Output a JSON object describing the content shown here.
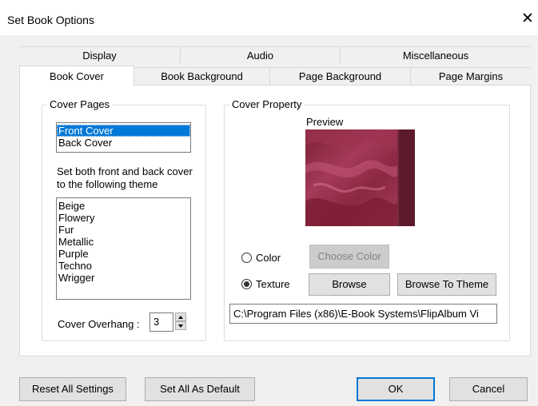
{
  "window": {
    "title": "Set Book Options",
    "close_glyph": "✕"
  },
  "tabs_back": [
    "Display",
    "Audio",
    "Miscellaneous"
  ],
  "tabs_front": [
    "Book Cover",
    "Book Background",
    "Page Background",
    "Page Margins"
  ],
  "cover_pages": {
    "group_label": "Cover Pages",
    "pages": [
      "Front Cover",
      "Back Cover"
    ],
    "selected_page": "Front Cover",
    "theme_instruction": "Set both front and back cover to the following theme",
    "themes": [
      "Beige",
      "Flowery",
      "Fur",
      "Metallic",
      "Purple",
      "Techno",
      "Wrigger"
    ],
    "overhang_label": "Cover Overhang :",
    "overhang_value": "3"
  },
  "cover_property": {
    "group_label": "Cover Property",
    "preview_label": "Preview",
    "color_label": "Color",
    "texture_label": "Texture",
    "selected_option": "Texture",
    "choose_color_label": "Choose Color",
    "browse_label": "Browse",
    "browse_theme_label": "Browse To Theme",
    "path_value": "C:\\Program Files (x86)\\E-Book Systems\\FlipAlbum Vi"
  },
  "footer": {
    "reset_label": "Reset All Settings",
    "set_default_label": "Set All As Default",
    "ok_label": "OK",
    "cancel_label": "Cancel"
  },
  "colors": {
    "selection": "#0078d7",
    "preview_base": "#8e2a44",
    "preview_edge": "#5c1a2c"
  }
}
